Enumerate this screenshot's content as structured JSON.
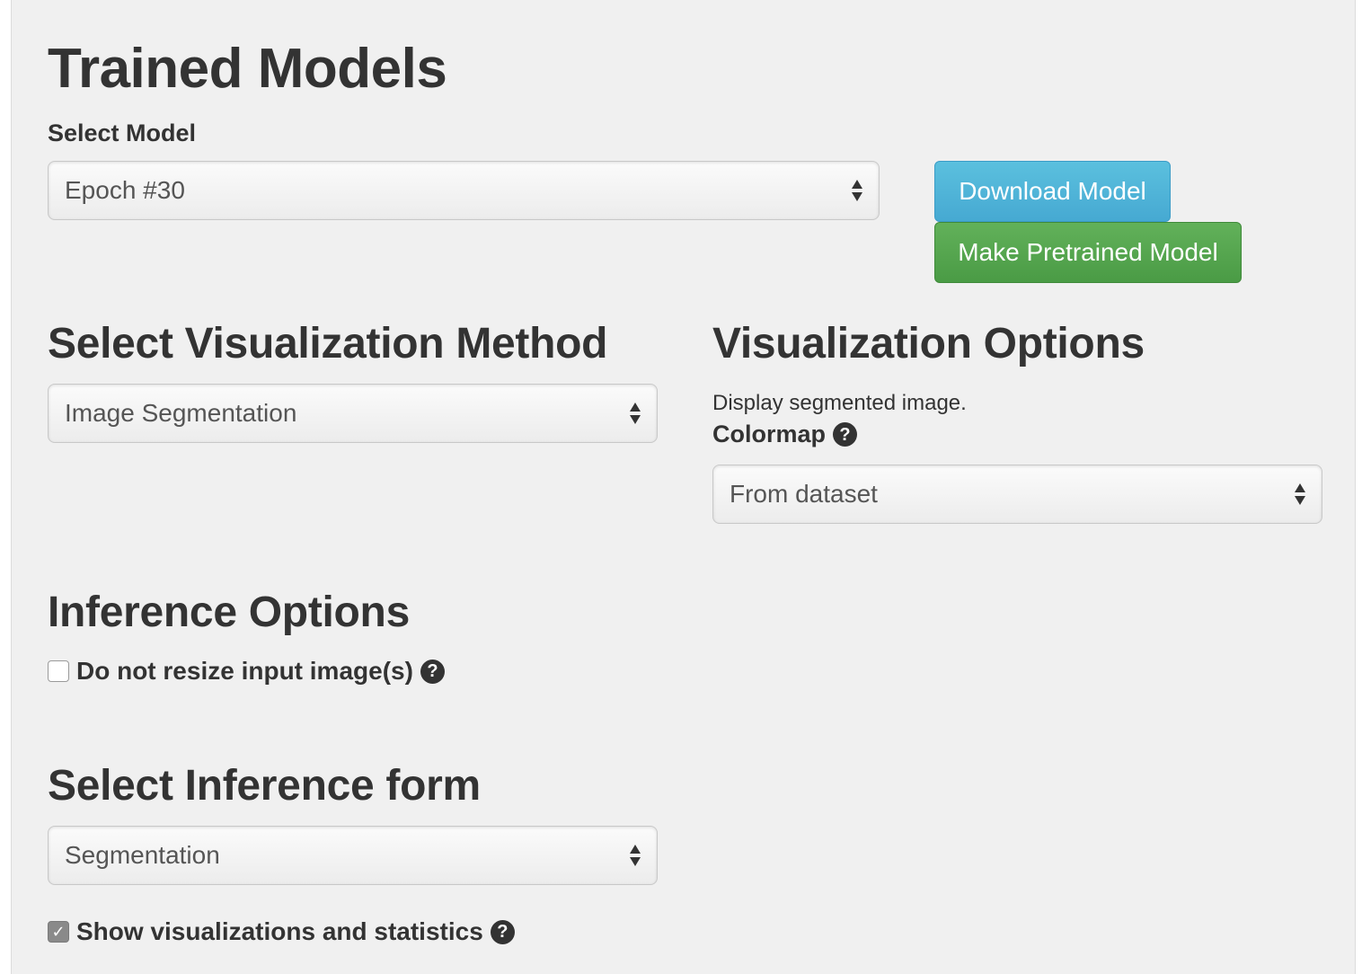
{
  "page": {
    "title": "Trained Models"
  },
  "model": {
    "label": "Select Model",
    "selected": "Epoch #30",
    "download_label": "Download Model",
    "pretrained_label": "Make Pretrained Model",
    "download_color": "#5bc0de",
    "pretrained_color": "#5cb85c"
  },
  "visualization_method": {
    "heading": "Select Visualization Method",
    "selected": "Image Segmentation"
  },
  "visualization_options": {
    "heading": "Visualization Options",
    "description": "Display segmented image.",
    "colormap_label": "Colormap",
    "colormap_selected": "From dataset",
    "help_glyph": "?"
  },
  "inference_options": {
    "heading": "Inference Options",
    "no_resize_label": "Do not resize input image(s)",
    "no_resize_checked": false,
    "help_glyph": "?"
  },
  "inference_form": {
    "heading": "Select Inference form",
    "selected": "Segmentation",
    "show_stats_label": "Show visualizations and statistics",
    "show_stats_checked": true,
    "check_glyph": "✓",
    "help_glyph": "?"
  }
}
